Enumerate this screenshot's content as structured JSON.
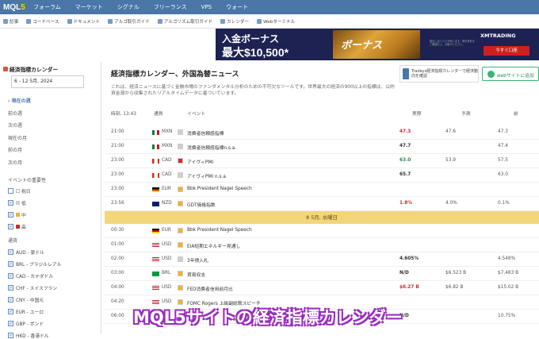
{
  "topnav": {
    "logo_a": "MQL",
    "logo_b": "5",
    "items": [
      "フォーラム",
      "マーケット",
      "シグナル",
      "フリーランス",
      "VPS",
      "ウォート"
    ]
  },
  "subnav": {
    "items": [
      "記事",
      "コードベース",
      "ドキュメント",
      "アルゴ取引ガイド",
      "アルゴリズム取引ガイド",
      "カレンダー",
      "Webターミナル"
    ]
  },
  "banner": {
    "line1": "入金ボーナス",
    "line2": "最大$10,500*",
    "mid": "ボーナス",
    "brand": "XMTRADING",
    "button": "今すぐ口座",
    "small": "取引にはリスクが伴います。取引条件をご確認の上、お取引ください。"
  },
  "sidebar": {
    "title": "経済指標カレンダー",
    "date": "6 - 12 5月, 2024",
    "periods": [
      "現在の週",
      "前の週",
      "次の週",
      "現在の月",
      "前の月",
      "次の月"
    ],
    "importance_title": "イベントの重要性",
    "importance": [
      {
        "label": "祝日",
        "checked": false,
        "color": "#ffffff"
      },
      {
        "label": "低",
        "checked": true,
        "color": "#cfcfcf"
      },
      {
        "label": "中",
        "checked": true,
        "color": "#f0b429"
      },
      {
        "label": "高",
        "checked": true,
        "color": "#d22b2b"
      }
    ],
    "currency_title": "通貨",
    "currencies": [
      "AUD - 豪ドル",
      "BRL - ブラジルレアル",
      "CAD - カナダドル",
      "CHF - スイスフラン",
      "CNY - 中国元",
      "EUR - ユーロ",
      "GBP - ポンド",
      "HKD - 香港ドル"
    ]
  },
  "main": {
    "title": "経済指標カレンダー、外国為替ニュース",
    "desc": "これは、経済ニュースに基づく金融市場のファンダメンタル分析のための不可欠なツールです。世界最大の経済の900以上の指標は、公的資金源から収集されたリアルタイムデータに基づいています。",
    "promo": "Tradays経済指標カレンダーで経済動向を確認",
    "web_button": "webサイトに追加",
    "headers": {
      "time": "時刻, 13:43",
      "currency": "通貨",
      "event": "イベント",
      "actual": "実際",
      "forecast": "予測",
      "previous": "前"
    },
    "day_band": "8 5月, 水曜日",
    "rows_a": [
      {
        "time": "21:00",
        "cur": "MXN",
        "imp": "#cfcfcf",
        "ev": "消費者信頼感指標",
        "act": "47.3",
        "act_color": "#d22b2b",
        "fc": "47.6",
        "prev": "47.3",
        "flag": "mx"
      },
      {
        "time": "21:00",
        "cur": "MXN",
        "imp": "#cfcfcf",
        "ev": "消費者信頼感指標n.s.a.",
        "act": "47.7",
        "act_color": "#333333",
        "fc": "",
        "prev": "47.4",
        "flag": "mx"
      },
      {
        "time": "23:00",
        "cur": "CAD",
        "imp": "#d22b2b",
        "ev": "アイヴィPMI",
        "act": "63.0",
        "act_color": "#2e8b57",
        "fc": "53.9",
        "prev": "57.5",
        "flag": "ca"
      },
      {
        "time": "23:00",
        "cur": "CAD",
        "imp": "#cfcfcf",
        "ev": "アイヴィPMI n.s.a",
        "act": "65.7",
        "act_color": "#333333",
        "fc": "",
        "prev": "63.0",
        "flag": "ca"
      },
      {
        "time": "23:00",
        "cur": "EUR",
        "imp": "#f0b429",
        "ev": "Bbk President Nagel Speech",
        "act": "",
        "act_color": "#333333",
        "fc": "",
        "prev": "",
        "flag": "de"
      },
      {
        "time": "23:56",
        "cur": "NZD",
        "imp": "#f0b429",
        "ev": "GDT価格指数",
        "act": "1.8%",
        "act_color": "#d22b2b",
        "fc": "4.0%",
        "prev": "0.1%",
        "flag": "nz"
      }
    ],
    "rows_b": [
      {
        "time": "00:30",
        "cur": "EUR",
        "imp": "#f0b429",
        "ev": "Bbk President Nagel Speech",
        "act": "",
        "act_color": "#333333",
        "fc": "",
        "prev": "",
        "flag": "de"
      },
      {
        "time": "01:00",
        "cur": "USD",
        "imp": "#f0b429",
        "ev": "EIA短期エネルギー見通し",
        "act": "",
        "act_color": "#333333",
        "fc": "",
        "prev": "",
        "flag": "us"
      },
      {
        "time": "02:00",
        "cur": "USD",
        "imp": "#cfcfcf",
        "ev": "3年債入札",
        "act": "4.605%",
        "act_color": "#333333",
        "fc": "",
        "prev": "4.548%",
        "flag": "us"
      },
      {
        "time": "03:00",
        "cur": "BRL",
        "imp": "#f0b429",
        "ev": "貿易収支",
        "act": "N/D",
        "act_color": "#333333",
        "fc": "$6.523 B",
        "prev": "$7.483 B",
        "flag": "br"
      },
      {
        "time": "04:00",
        "cur": "USD",
        "imp": "#f0b429",
        "ev": "FED消費者信用前月比",
        "act": "$6.27 B",
        "act_color": "#d22b2b",
        "fc": "$6.82 B",
        "prev": "$15.02 B",
        "flag": "us"
      },
      {
        "time": "04:20",
        "cur": "USD",
        "imp": "#f0b429",
        "ev": "FOMC Rogers 上級副総裁スピーチ",
        "act": "",
        "act_color": "#333333",
        "fc": "",
        "prev": "",
        "flag": "us"
      },
      {
        "time": "06:00",
        "cur": "",
        "imp": "#cfcfcf",
        "ev": "",
        "act": "N/D",
        "act_color": "#333333",
        "fc": "",
        "prev": "10.75%",
        "flag": ""
      }
    ]
  },
  "overlay": "MQL5サイトの経済指標カレンダー"
}
